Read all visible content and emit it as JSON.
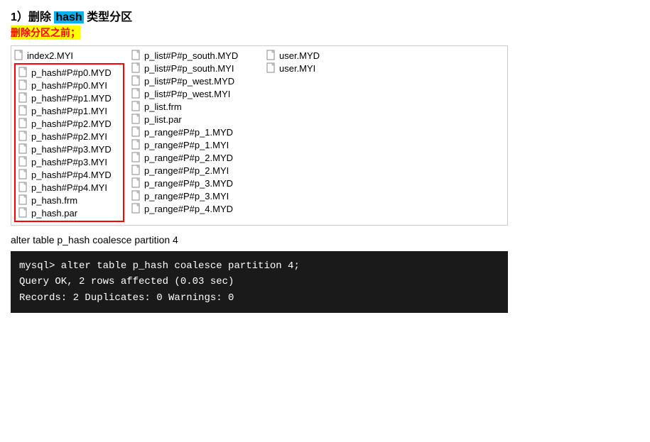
{
  "title": {
    "step": "1）删除",
    "keyword": "hash",
    "rest": " 类型分区",
    "subtitle": "删除分区之前；"
  },
  "file_columns": {
    "col1_items": [
      "p_hash#P#p0.MYD",
      "p_hash#P#p0.MYI",
      "p_hash#P#p1.MYD",
      "p_hash#P#p1.MYI",
      "p_hash#P#p2.MYD",
      "p_hash#P#p2.MYI",
      "p_hash#P#p3.MYD",
      "p_hash#P#p3.MYI",
      "p_hash#P#p4.MYD",
      "p_hash#P#p4.MYI",
      "p_hash.frm",
      "p_hash.par"
    ],
    "col2_header": "p_list#P#p_south.MYD",
    "col2_items": [
      "p_list#P#p_south.MYD",
      "p_list#P#p_south.MYI",
      "p_list#P#p_west.MYD",
      "p_list#P#p_west.MYI",
      "p_list.frm",
      "p_list.par",
      "p_range#P#p_1.MYD",
      "p_range#P#p_1.MYI",
      "p_range#P#p_2.MYD",
      "p_range#P#p_2.MYI",
      "p_range#P#p_3.MYD",
      "p_range#P#p_3.MYI",
      "p_range#P#p_4.MYD"
    ],
    "col3_items": [
      "user.MYD",
      "user.MYI"
    ],
    "col0_header_items": [
      "index2.MYI"
    ]
  },
  "sql_command": "alter table p_hash    coalesce partition 4",
  "terminal": {
    "line1": "mysql> alter table p_hash  coalesce partition 4;",
    "line2": "Query OK, 2 rows affected (0.03 sec)",
    "line3": "Records: 2  Duplicates: 0  Warnings: 0"
  }
}
